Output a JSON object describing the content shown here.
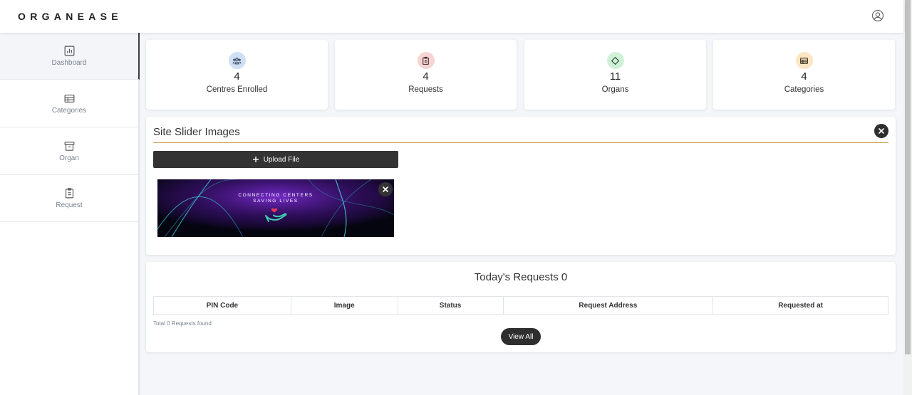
{
  "app": {
    "logo": "ORGANEASE"
  },
  "header": {
    "user_icon": "user-circle-icon"
  },
  "sidebar": {
    "items": [
      {
        "label": "Dashboard",
        "icon": "bar-chart-icon",
        "active": true
      },
      {
        "label": "Categories",
        "icon": "table-icon",
        "active": false
      },
      {
        "label": "Organ",
        "icon": "archive-box-icon",
        "active": false
      },
      {
        "label": "Request",
        "icon": "clipboard-icon",
        "active": false
      }
    ]
  },
  "stats": [
    {
      "value": "4",
      "label": "Centres Enrolled",
      "icon": "users-icon",
      "color": "#cfe0f5"
    },
    {
      "value": "4",
      "label": "Requests",
      "icon": "clipboard-icon",
      "color": "#f8d3d3"
    },
    {
      "value": "11",
      "label": "Organs",
      "icon": "diamond-icon",
      "color": "#d0f1d8"
    },
    {
      "value": "4",
      "label": "Categories",
      "icon": "table-icon",
      "color": "#fbe6c4"
    }
  ],
  "slider": {
    "title": "Site Slider Images",
    "upload_label": "Upload File",
    "slide_text_line1": "CONNECTING CENTERS",
    "slide_text_line2": "SAVING LIVES"
  },
  "requests": {
    "title": "Today's Requests 0",
    "columns": [
      "PIN Code",
      "Image",
      "Status",
      "Request Address",
      "Requested at"
    ],
    "footer": "Total 0 Requests found",
    "view_all_label": "View All"
  },
  "colors": {
    "accent_rule": "#c9a04a",
    "dark": "#2e2e2e"
  }
}
